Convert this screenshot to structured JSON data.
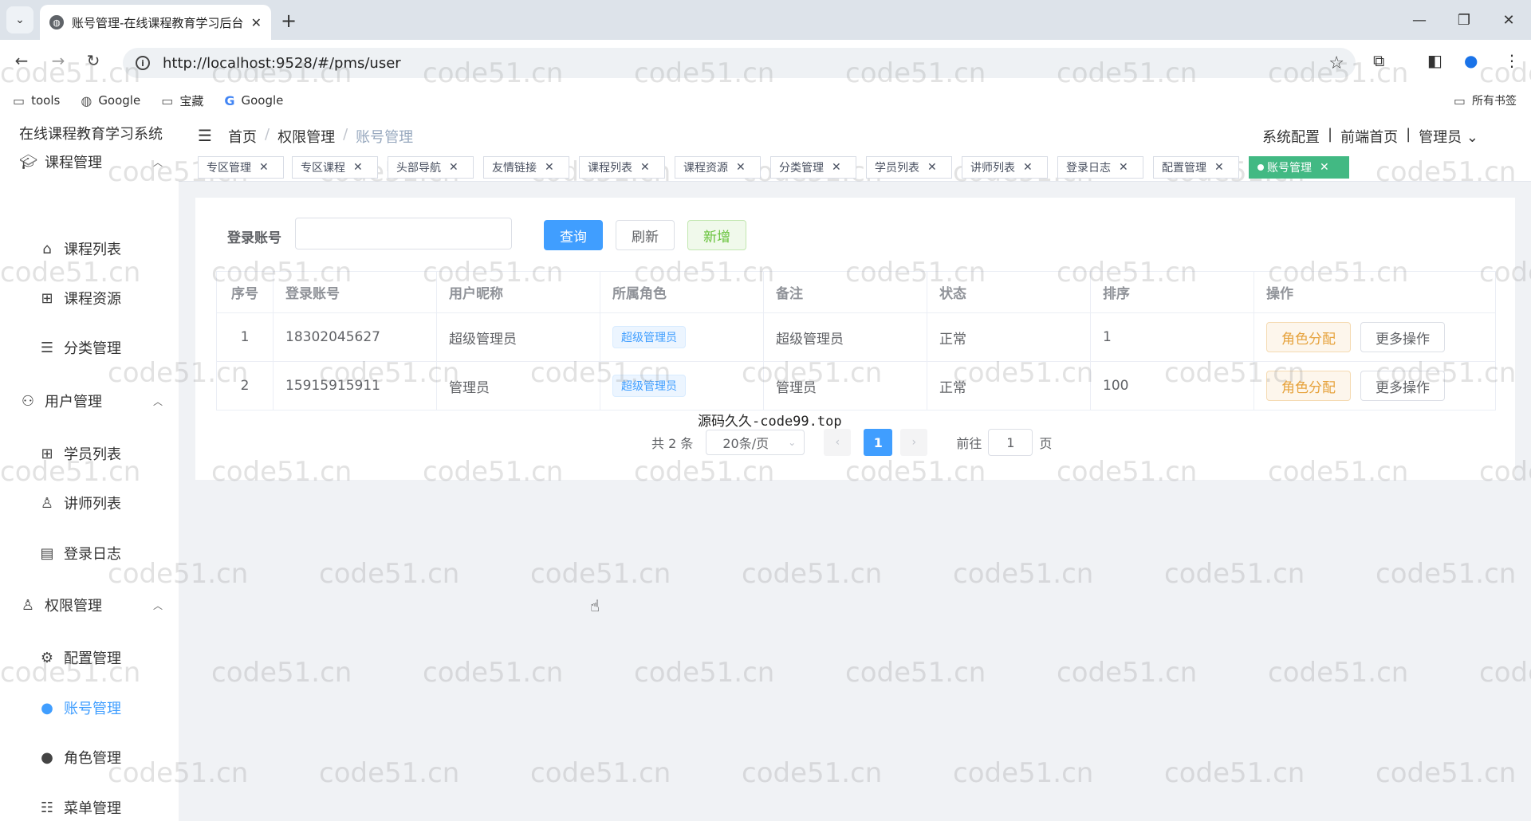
{
  "browser": {
    "tab_title": "账号管理-在线课程教育学习后台",
    "url": "http://localhost:9528/#/pms/user",
    "bookmarks": [
      "tools",
      "Google",
      "宝藏",
      "Google"
    ],
    "all_bookmarks": "所有书签"
  },
  "app": {
    "logo": "在线课程教育学习系统",
    "breadcrumb": [
      "首页",
      "权限管理",
      "账号管理"
    ],
    "header_links": [
      "系统配置",
      "前端首页",
      "管理员"
    ],
    "sidebar": [
      {
        "type": "group",
        "label": "课程管理",
        "icon": "graduation-cap-icon"
      },
      {
        "type": "item",
        "label": "课程列表",
        "icon": "graduation-cap-icon"
      },
      {
        "type": "item",
        "label": "课程资源",
        "icon": "grid-icon"
      },
      {
        "type": "item",
        "label": "分类管理",
        "icon": "list-icon"
      },
      {
        "type": "group",
        "label": "用户管理",
        "icon": "users-icon"
      },
      {
        "type": "item",
        "label": "学员列表",
        "icon": "grid-icon"
      },
      {
        "type": "item",
        "label": "讲师列表",
        "icon": "user-icon"
      },
      {
        "type": "item",
        "label": "登录日志",
        "icon": "document-icon"
      },
      {
        "type": "group",
        "label": "权限管理",
        "icon": "user-icon"
      },
      {
        "type": "item",
        "label": "配置管理",
        "icon": "gear-icon"
      },
      {
        "type": "item",
        "label": "账号管理",
        "icon": "user-solid-icon",
        "active": true
      },
      {
        "type": "item",
        "label": "角色管理",
        "icon": "user-solid-icon"
      },
      {
        "type": "item",
        "label": "菜单管理",
        "icon": "tree-list-icon"
      }
    ],
    "tags": [
      "专区管理",
      "专区课程",
      "头部导航",
      "友情链接",
      "课程列表",
      "课程资源",
      "分类管理",
      "学员列表",
      "讲师列表",
      "登录日志",
      "配置管理",
      "账号管理"
    ],
    "active_tag": "账号管理"
  },
  "filter": {
    "label": "登录账号",
    "input_value": "",
    "buttons": {
      "query": "查询",
      "refresh": "刷新",
      "add": "新增"
    }
  },
  "table": {
    "columns": [
      "序号",
      "登录账号",
      "用户昵称",
      "所属角色",
      "备注",
      "状态",
      "排序",
      "操作"
    ],
    "rows": [
      {
        "index": "1",
        "account": "18302045627",
        "nickname": "超级管理员",
        "role": "超级管理员",
        "remark": "超级管理员",
        "status": "正常",
        "sort": "1",
        "op1": "角色分配",
        "op2": "更多操作"
      },
      {
        "index": "2",
        "account": "15915915911",
        "nickname": "管理员",
        "role": "超级管理员",
        "remark": "管理员",
        "status": "正常",
        "sort": "100",
        "op1": "角色分配",
        "op2": "更多操作"
      }
    ]
  },
  "footer_text": "源码久久-code99.top",
  "pagination": {
    "total": "共 2 条",
    "page_size": "20条/页",
    "current": "1",
    "goto_prefix": "前往",
    "goto_value": "1",
    "goto_suffix": "页"
  },
  "watermark": "code51.cn"
}
